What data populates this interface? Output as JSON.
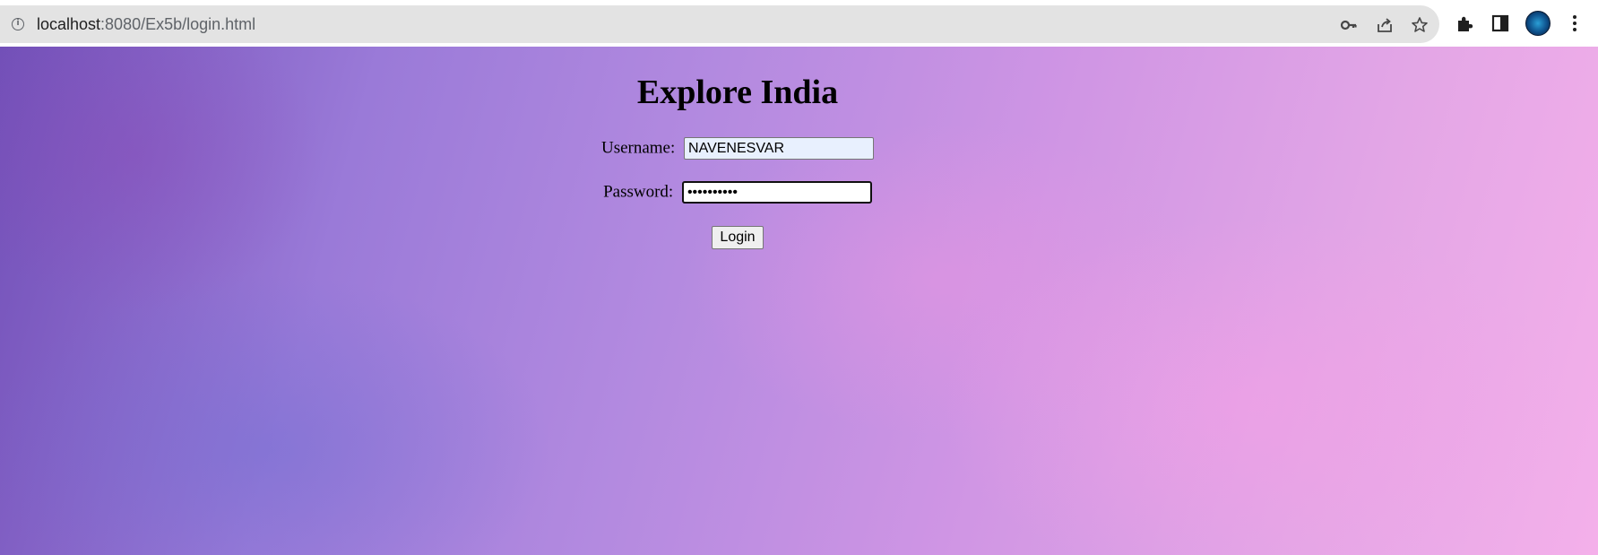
{
  "browser": {
    "url_host": "localhost",
    "url_path": ":8080/Ex5b/login.html",
    "icons": [
      "info-icon",
      "key-icon",
      "share-icon",
      "star-icon",
      "extensions-icon",
      "side-panel-icon",
      "avatar",
      "menu-icon"
    ]
  },
  "page": {
    "title": "Explore India",
    "username_label": "Username:",
    "username_value": "NAVENESVAR",
    "password_label": "Password:",
    "password_value": "••••••••••",
    "login_label": "Login"
  },
  "colors": {
    "background_start": "#7250b8",
    "background_end": "#f4b0ea",
    "omnibox": "#e3e3e3",
    "autofill": "#e8f0fe"
  }
}
